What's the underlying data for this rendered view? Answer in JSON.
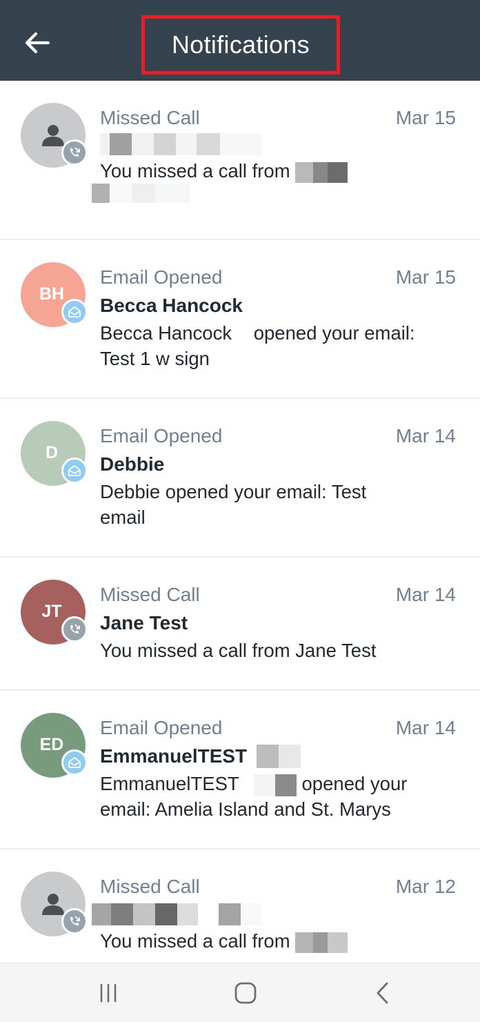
{
  "app_bar": {
    "title": "Notifications",
    "back_icon": "arrow-left-icon",
    "highlight_color": "#ec1c24",
    "background": "#35434e"
  },
  "notifications": [
    {
      "type": "Missed Call",
      "date": "Mar 15",
      "name": "",
      "message": "You missed a call from",
      "avatar": {
        "initials": "",
        "color": "#c9cacb",
        "icon": "person-icon"
      },
      "badge_icon": "missed-call-icon"
    },
    {
      "type": "Email Opened",
      "date": "Mar 15",
      "name": "Becca Hancock",
      "message_line1": "Becca Hancock",
      "message_line1b": "opened your email:",
      "message_line2": "Test 1 w sign",
      "avatar": {
        "initials": "BH",
        "color": "#f6a493"
      },
      "badge_icon": "email-opened-icon"
    },
    {
      "type": "Email Opened",
      "date": "Mar 14",
      "name": "Debbie",
      "message_line1": "Debbie opened your email: Test",
      "message_line2": "email",
      "avatar": {
        "initials": "D",
        "color": "#b8cbb9"
      },
      "badge_icon": "email-opened-icon"
    },
    {
      "type": "Missed Call",
      "date": "Mar 14",
      "name": "Jane Test",
      "message": "You missed a call from Jane Test",
      "avatar": {
        "initials": "JT",
        "color": "#a6605d"
      },
      "badge_icon": "missed-call-icon"
    },
    {
      "type": "Email Opened",
      "date": "Mar 14",
      "name": "EmmanuelTEST",
      "message_line1a": "EmmanuelTEST",
      "message_line1b": "opened your",
      "message_line2": "email: Amelia Island and St. Marys",
      "avatar": {
        "initials": "ED",
        "color": "#799b7d"
      },
      "badge_icon": "email-opened-icon"
    },
    {
      "type": "Missed Call",
      "date": "Mar 12",
      "name": "",
      "message": "You missed a call from",
      "avatar": {
        "initials": "",
        "color": "#c9cacb",
        "icon": "person-icon"
      },
      "badge_icon": "missed-call-icon"
    }
  ],
  "nav_bar": {
    "recents_icon": "recents-icon",
    "home_icon": "home-icon",
    "back_icon": "back-chevron-icon"
  }
}
